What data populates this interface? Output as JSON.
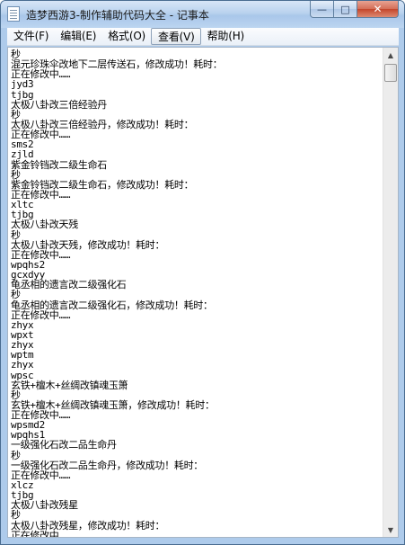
{
  "window": {
    "title": "造梦西游3-制作辅助代码大全 - 记事本",
    "controls": {
      "minimize": "—",
      "maximize": "□",
      "close": "✕"
    }
  },
  "menu": [
    {
      "label": "文件(F)"
    },
    {
      "label": "编辑(E)"
    },
    {
      "label": "格式(O)"
    },
    {
      "label": "查看(V)",
      "active": true
    },
    {
      "label": "帮助(H)"
    }
  ],
  "editor": {
    "lines": [
      "秒",
      "混元珍珠伞改地下二层传送石，修改成功！耗时：",
      "正在修改中……",
      "jyd3",
      "tjbg",
      "太极八卦改三倍经验丹",
      "秒",
      "太极八卦改三倍经验丹，修改成功！耗时：",
      "正在修改中……",
      "sms2",
      "zjld",
      "紫金铃铛改二级生命石",
      "秒",
      "紫金铃铛改二级生命石，修改成功！耗时：",
      "正在修改中……",
      "xltc",
      "tjbg",
      "太极八卦改天残",
      "秒",
      "太极八卦改天残，修改成功！耗时：",
      "正在修改中……",
      "wpqhs2",
      "gcxdyy",
      "龟丞相的遗言改二级强化石",
      "秒",
      "龟丞相的遗言改二级强化石，修改成功！耗时：",
      "正在修改中……",
      "zhyx",
      "wpxt",
      "zhyx",
      "wptm",
      "zhyx",
      "wpsc",
      "玄铁+檀木+丝绸改镇魂玉箫",
      "秒",
      "玄铁+檀木+丝绸改镇魂玉箫，修改成功！耗时：",
      "正在修改中……",
      "wpsmd2",
      "wpqhs1",
      "一级强化石改二品生命丹",
      "秒",
      "一级强化石改二品生命丹，修改成功！耗时：",
      "正在修改中……",
      "xlcz",
      "tjbg",
      "太极八卦改残星",
      "秒",
      "太极八卦改残星，修改成功！耗时：",
      "正在修改中……"
    ]
  },
  "scrollbar": {
    "up_arrow": "▲",
    "down_arrow": "▼",
    "position": 0.0
  }
}
